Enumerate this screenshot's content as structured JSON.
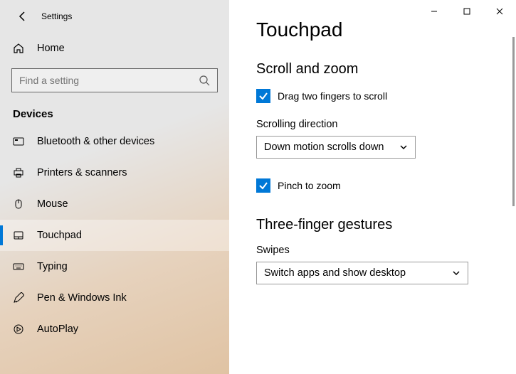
{
  "window": {
    "title": "Settings",
    "controls": {
      "min": "−",
      "max": "☐",
      "close": "✕"
    }
  },
  "sidebar": {
    "home": "Home",
    "search_placeholder": "Find a setting",
    "section": "Devices",
    "items": [
      {
        "icon": "bluetooth",
        "label": "Bluetooth & other devices"
      },
      {
        "icon": "printer",
        "label": "Printers & scanners"
      },
      {
        "icon": "mouse",
        "label": "Mouse"
      },
      {
        "icon": "touchpad",
        "label": "Touchpad",
        "selected": true
      },
      {
        "icon": "typing",
        "label": "Typing"
      },
      {
        "icon": "pen",
        "label": "Pen & Windows Ink"
      },
      {
        "icon": "autoplay",
        "label": "AutoPlay"
      }
    ]
  },
  "main": {
    "title": "Touchpad",
    "scroll_zoom": {
      "heading": "Scroll and zoom",
      "drag_checkbox": {
        "label": "Drag two fingers to scroll",
        "checked": true
      },
      "direction_label": "Scrolling direction",
      "direction_value": "Down motion scrolls down",
      "pinch_checkbox": {
        "label": "Pinch to zoom",
        "checked": true
      }
    },
    "three_finger": {
      "heading": "Three-finger gestures",
      "swipes_label": "Swipes",
      "swipes_value": "Switch apps and show desktop"
    }
  },
  "colors": {
    "accent": "#0078d7"
  }
}
